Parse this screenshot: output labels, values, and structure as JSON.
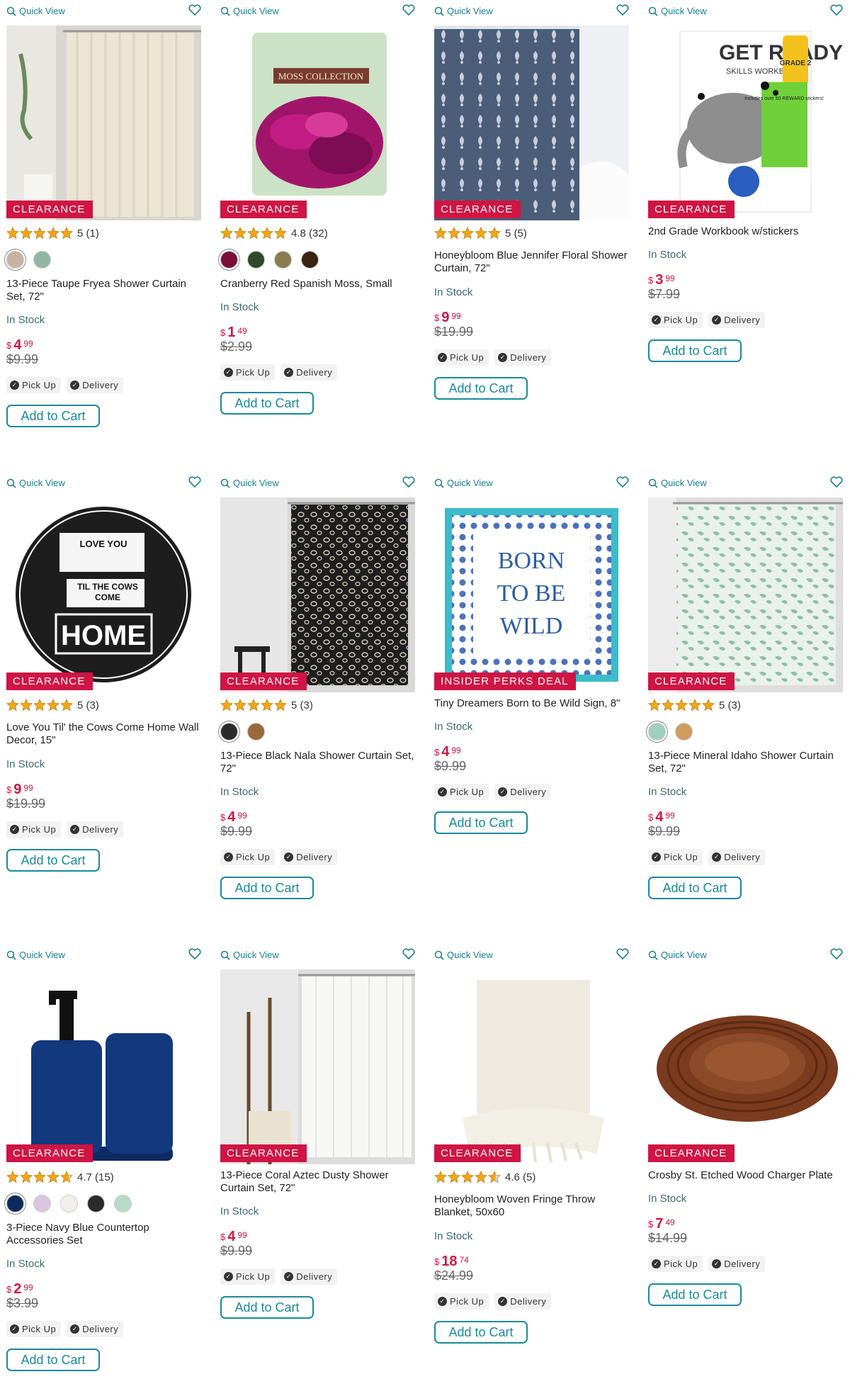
{
  "common": {
    "quick_view": "Quick View",
    "in_stock": "In Stock",
    "pick_up": "Pick Up",
    "delivery": "Delivery",
    "add_to_cart": "Add to Cart",
    "currency": "$"
  },
  "products": [
    {
      "badge": "CLEARANCE",
      "rating": "5 (1)",
      "swatches": [
        "#c7b3a3",
        "#8fb7a4"
      ],
      "title": "13-Piece Taupe Fryea Shower Curtain Set, 72\"",
      "price_dollars": "4",
      "price_cents": "99",
      "was": "$9.99",
      "image": "curtain-cream"
    },
    {
      "badge": "CLEARANCE",
      "rating": "4.8 (32)",
      "swatches": [
        "#7a0d3a",
        "#2f4a2a",
        "#8a7a50",
        "#3a2410"
      ],
      "title": "Cranberry Red Spanish Moss, Small",
      "price_dollars": "1",
      "price_cents": "49",
      "was": "$2.99",
      "image": "moss-bag"
    },
    {
      "badge": "CLEARANCE",
      "rating": "5 (5)",
      "swatches": [],
      "title": "Honeybloom Blue Jennifer Floral Shower Curtain, 72\"",
      "price_dollars": "9",
      "price_cents": "99",
      "was": "$19.99",
      "image": "curtain-blue"
    },
    {
      "badge": "CLEARANCE",
      "rating": "",
      "swatches": [],
      "title": "2nd Grade Workbook w/stickers",
      "price_dollars": "3",
      "price_cents": "99",
      "was": "$7.99",
      "image": "workbook"
    },
    {
      "badge": "CLEARANCE",
      "rating": "5 (3)",
      "swatches": [],
      "title": "Love You Til' the Cows Come Home Wall Decor, 15\"",
      "price_dollars": "9",
      "price_cents": "99",
      "was": "$19.99",
      "image": "cows-sign"
    },
    {
      "badge": "CLEARANCE",
      "rating": "5 (3)",
      "swatches": [
        "#2b2b2b",
        "#9a6a3a"
      ],
      "title": "13-Piece Black Nala Shower Curtain Set, 72\"",
      "price_dollars": "4",
      "price_cents": "99",
      "was": "$9.99",
      "image": "curtain-black"
    },
    {
      "badge": "INSIDER PERKS DEAL",
      "rating": "",
      "swatches": [],
      "title": "Tiny Dreamers Born to Be Wild Sign, 8\"",
      "price_dollars": "4",
      "price_cents": "99",
      "was": "$9.99",
      "image": "wild-sign"
    },
    {
      "badge": "CLEARANCE",
      "rating": "5 (3)",
      "swatches": [
        "#9fcfbf",
        "#d09a60"
      ],
      "title": "13-Piece Mineral Idaho Shower Curtain Set, 72\"",
      "price_dollars": "4",
      "price_cents": "99",
      "was": "$9.99",
      "image": "curtain-mint"
    },
    {
      "badge": "CLEARANCE",
      "rating": "4.7 (15)",
      "swatches": [
        "#0e2a5c",
        "#d9c6e0",
        "#f0f0e8",
        "#2b2b2b",
        "#b6dcc8"
      ],
      "title": "3-Piece Navy Blue Countertop Accessories Set",
      "price_dollars": "2",
      "price_cents": "99",
      "was": "$3.99",
      "image": "navy-set"
    },
    {
      "badge": "CLEARANCE",
      "rating": "",
      "swatches": [],
      "title": "13-Piece Coral Aztec Dusty Shower Curtain Set, 72\"",
      "price_dollars": "4",
      "price_cents": "99",
      "was": "$9.99",
      "image": "curtain-white"
    },
    {
      "badge": "CLEARANCE",
      "rating": "4.6 (5)",
      "swatches": [],
      "title": "Honeybloom Woven Fringe Throw Blanket, 50x60",
      "price_dollars": "18",
      "price_cents": "74",
      "was": "$24.99",
      "image": "throw"
    },
    {
      "badge": "CLEARANCE",
      "rating": "",
      "swatches": [],
      "title": "Crosby St. Etched Wood Charger Plate",
      "price_dollars": "7",
      "price_cents": "49",
      "was": "$14.99",
      "image": "wood-plate"
    }
  ],
  "colors": {
    "accent": "#1a8a99",
    "sale": "#d01444",
    "star": "#f2a516"
  },
  "image_text": {
    "workbook_title": "GET READY",
    "workbook_sub": "SKILLS WORKBOOK",
    "workbook_grade": "GRADE 2",
    "workbook_sticker": "Includes over 50 REWARD stickers!",
    "moss_label": "MOSS COLLECTION",
    "cows_love": "LOVE YOU",
    "cows_til": "TIL THE COWS",
    "cows_come": "COME",
    "cows_home": "HOME",
    "wild_1": "BORN",
    "wild_2": "TO BE",
    "wild_3": "WILD"
  }
}
